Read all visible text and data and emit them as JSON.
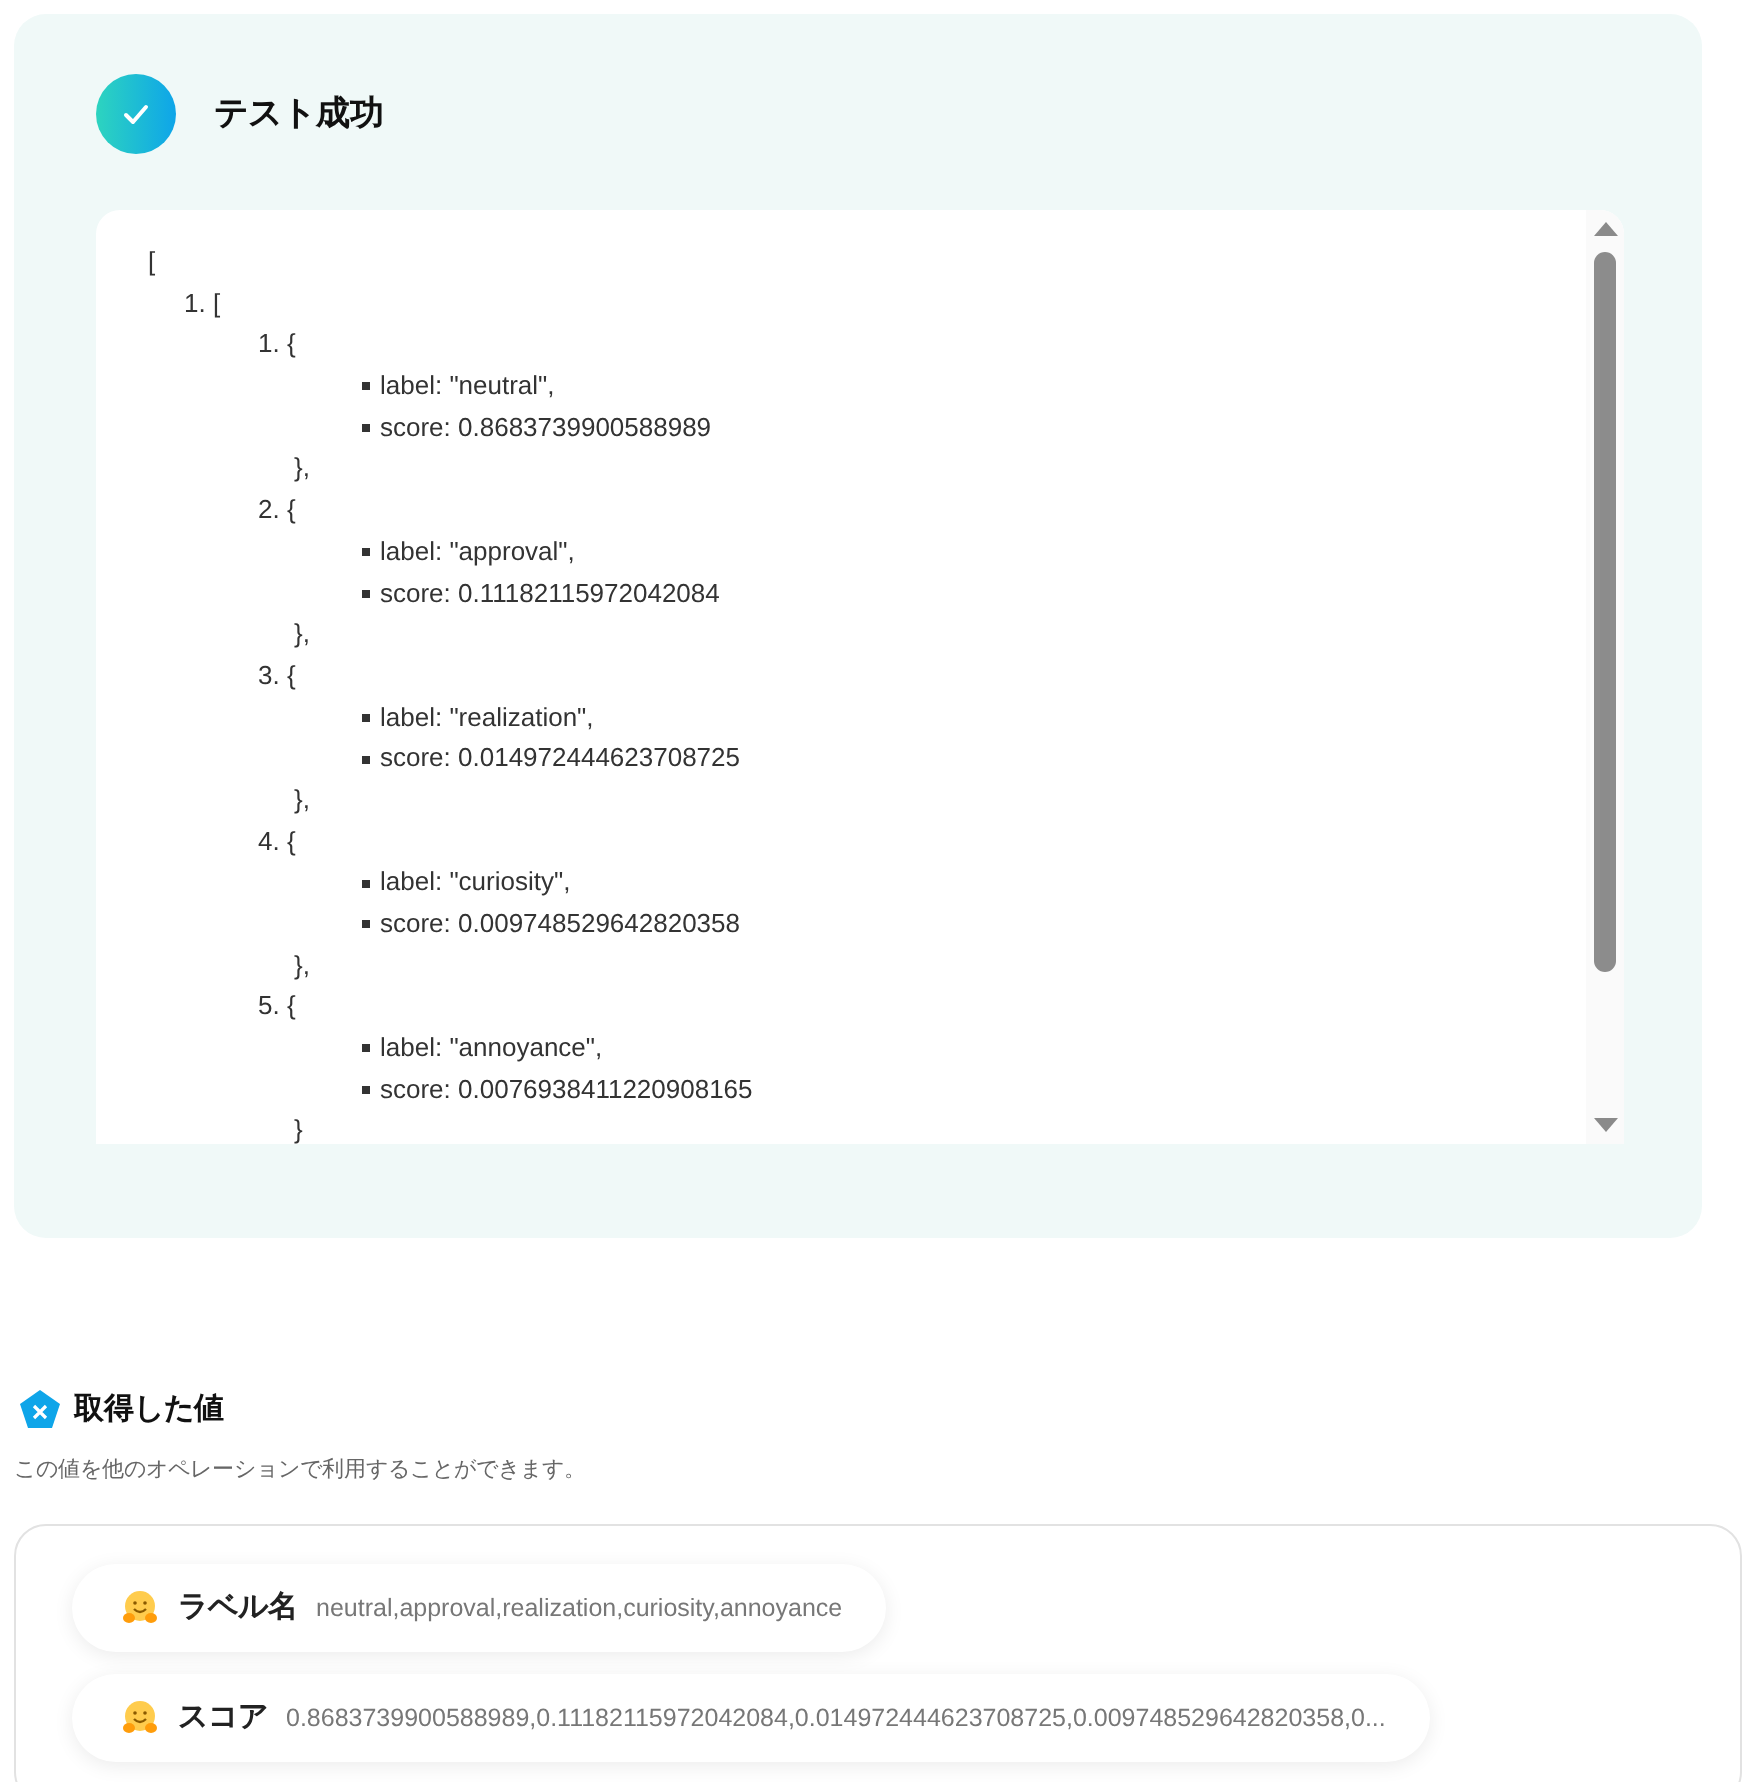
{
  "test_result": {
    "success": true,
    "title": "テスト成功"
  },
  "output": {
    "open": "[",
    "items": [
      {
        "number": "1.",
        "open": "[",
        "objects": [
          {
            "number": "1.",
            "open": "{",
            "fields": [
              "label: \"neutral\",",
              "score: 0.8683739900588989"
            ],
            "close": "},"
          },
          {
            "number": "2.",
            "open": "{",
            "fields": [
              "label: \"approval\",",
              "score: 0.11182115972042084"
            ],
            "close": "},"
          },
          {
            "number": "3.",
            "open": "{",
            "fields": [
              "label: \"realization\",",
              "score: 0.014972444623708725"
            ],
            "close": "},"
          },
          {
            "number": "4.",
            "open": "{",
            "fields": [
              "label: \"curiosity\",",
              "score: 0.009748529642820358"
            ],
            "close": "},"
          },
          {
            "number": "5.",
            "open": "{",
            "fields": [
              "label: \"annoyance\",",
              "score: 0.0076938411220908165"
            ],
            "close": "}"
          }
        ]
      }
    ]
  },
  "values_section": {
    "title": "取得した値",
    "description": "この値を他のオペレーションで利用することができます。",
    "values": [
      {
        "name": "ラベル名",
        "value": "neutral,approval,realization,curiosity,annoyance"
      },
      {
        "name": "スコア",
        "value": "0.8683739900588989,0.11182115972042084,0.014972444623708725,0.009748529642820358,0..."
      }
    ]
  }
}
